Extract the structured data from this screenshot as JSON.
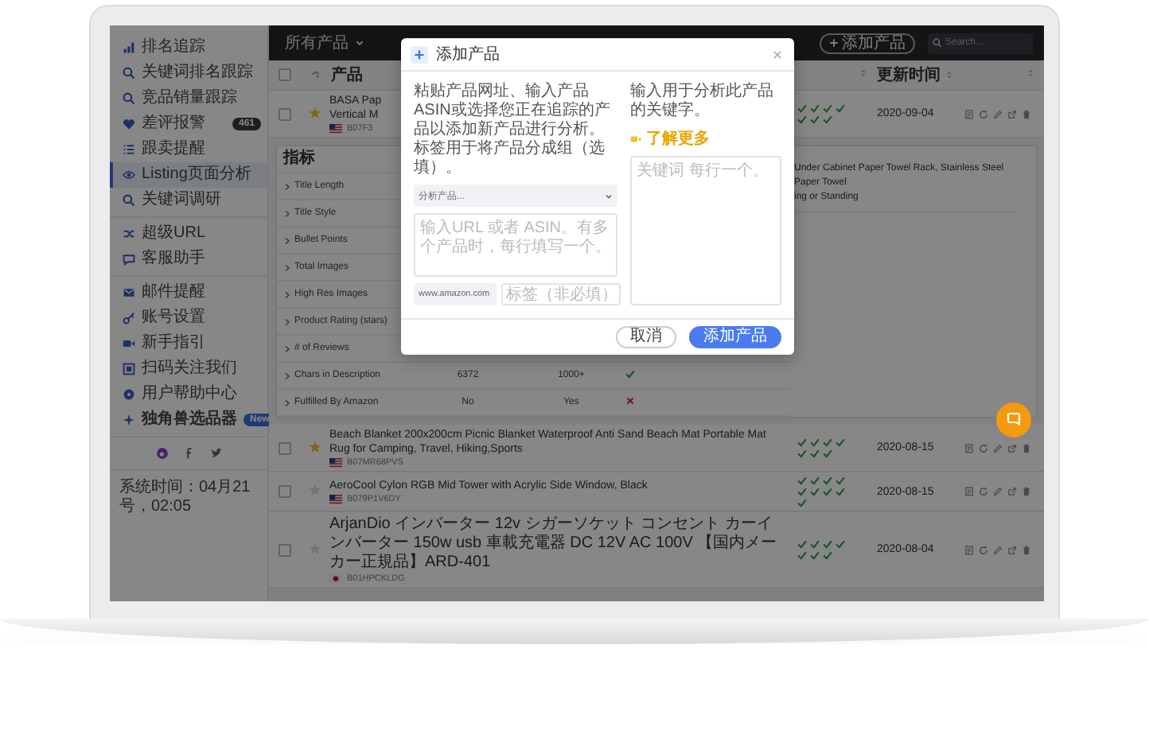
{
  "topbar": {
    "filter": "所有产品",
    "add_button": "添加产品",
    "search": {
      "placeholder": "Search..."
    }
  },
  "sidebar": {
    "groups": [
      {
        "items": [
          {
            "label": "排名追踪",
            "selected": false,
            "bold": false
          },
          {
            "label": "关键词排名跟踪",
            "selected": false,
            "bold": false
          },
          {
            "label": "竞品销量跟踪",
            "selected": false,
            "bold": false
          },
          {
            "label": "差评报警",
            "selected": false,
            "bold": false,
            "badge": {
              "text": "461",
              "kind": "count"
            }
          },
          {
            "label": "跟卖提醒",
            "selected": false,
            "bold": false
          },
          {
            "label": "Listing页面分析",
            "selected": true,
            "bold": false
          },
          {
            "label": "关键词调研",
            "selected": false,
            "bold": false
          }
        ]
      },
      {
        "items": [
          {
            "label": "超级URL",
            "selected": false,
            "bold": false
          },
          {
            "label": "客服助手",
            "selected": false,
            "bold": false
          }
        ]
      },
      {
        "items": [
          {
            "label": "邮件提醒",
            "selected": false,
            "bold": false
          },
          {
            "label": "账号设置",
            "selected": false,
            "bold": false
          },
          {
            "label": "新手指引",
            "selected": false,
            "bold": false
          },
          {
            "label": "扫码关注我们",
            "selected": false,
            "bold": false
          },
          {
            "label": "用户帮助中心",
            "selected": false,
            "bold": false
          },
          {
            "label": "独角兽选品器",
            "selected": false,
            "bold": true,
            "badge": {
              "text": "New",
              "kind": "new"
            }
          }
        ]
      }
    ],
    "footer": "系统时间：04月21号，02:05"
  },
  "table": {
    "header": {
      "checked": false,
      "product": "产品",
      "updated": "更新时间"
    },
    "rows": [
      {
        "checked": false,
        "starred": true,
        "title_lines": [
          "BASA Pap",
          "Vertical M"
        ],
        "kind": "us",
        "asin": "B07F3",
        "checks": [
          {
            "passed": true
          },
          {
            "passed": true
          },
          {
            "passed": true
          },
          {
            "passed": true
          },
          {
            "passed": true
          },
          {
            "passed": true
          },
          {
            "passed": true
          }
        ],
        "date": "2020-09-04",
        "details": {
          "heading": "指标",
          "metrics": [
            {
              "name": "Title Length"
            },
            {
              "name": "Title Style"
            },
            {
              "name": "Bullet Points"
            },
            {
              "name": "Total Images"
            },
            {
              "name": "High Res Images"
            },
            {
              "name": "Product Rating (stars)"
            },
            {
              "name": "# of Reviews"
            },
            {
              "name": "Chars in Description",
              "value": "6372",
              "target": "1000+",
              "passed": true
            },
            {
              "name": "Fulfilled By Amazon",
              "value": "No",
              "target": "Yes",
              "passed": false
            }
          ],
          "title_compare": [
            "Under Cabinet Paper Towel Rack, Stainless Steel Paper Towel",
            "ing or Standing"
          ]
        }
      },
      {
        "checked": false,
        "starred": true,
        "title_lines": [
          "Beach Blanket 200x200cm Picnic Blanket Waterproof Anti Sand Beach Mat Portable Mat Rug for Camping, Travel, Hiking,Sports"
        ],
        "kind": "us",
        "asin": "B07MR68PVS",
        "checks": [
          {
            "passed": true
          },
          {
            "passed": true
          },
          {
            "passed": true
          },
          {
            "passed": true
          },
          {
            "passed": true
          },
          {
            "passed": true
          },
          {
            "passed": true
          }
        ],
        "date": "2020-08-15"
      },
      {
        "checked": false,
        "starred": false,
        "title_lines": [
          "AeroCool Cylon RGB Mid Tower with Acrylic Side Window, Black"
        ],
        "kind": "us",
        "asin": "B079P1V6DY",
        "checks": [
          {
            "passed": true
          },
          {
            "passed": true
          },
          {
            "passed": true
          },
          {
            "passed": true
          },
          {
            "passed": true
          },
          {
            "passed": true
          },
          {
            "passed": true
          },
          {
            "passed": true
          },
          {
            "passed": true
          }
        ],
        "date": "2020-08-15"
      },
      {
        "checked": false,
        "starred": false,
        "title_lines": [
          "ArjanDio インバーター 12v シガーソケット コンセント カーインバーター 150w usb 車載充電器 DC 12V AC 100V 【国内メーカー正規品】ARD-401"
        ],
        "kind": "jp",
        "asin": "B01HPCKLDG",
        "checks": [
          {
            "passed": true
          },
          {
            "passed": true
          },
          {
            "passed": true
          },
          {
            "passed": true
          },
          {
            "passed": true
          },
          {
            "passed": true
          },
          {
            "passed": true
          }
        ],
        "date": "2020-08-04"
      }
    ]
  },
  "modal": {
    "title": "添加产品",
    "intro": "粘贴产品网址、输入产品ASIN或选择您正在追踪的产品以添加新产品进行分析。标签用于将产品分成组（选填）。",
    "product_select": "分析产品...",
    "urls": {
      "placeholder": "输入URL 或者 ASIN。有多个产品时，每行填写一个。"
    },
    "marketplace": "www.amazon.com",
    "tag": {
      "placeholder": "标签（非必填）"
    },
    "keywords_intro": "输入用于分析此产品的关键字。",
    "learn_more": "了解更多",
    "keywords": {
      "placeholder": "关键词 每行一个。"
    },
    "cancel": "取消",
    "submit": "添加产品"
  }
}
